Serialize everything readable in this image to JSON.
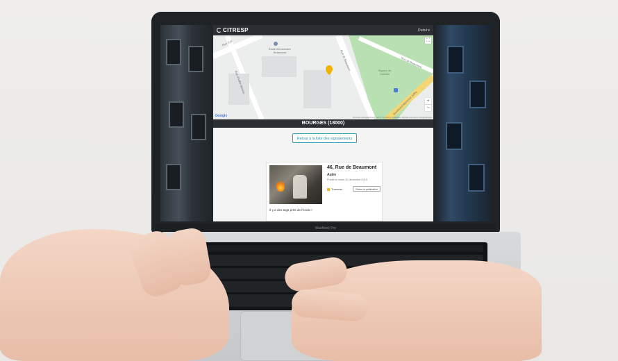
{
  "app": {
    "brand": "CITRESP",
    "user_menu": "Dudul ▾"
  },
  "map": {
    "streets": [
      "Rue Coli",
      "Rue d'Abbé Moreau",
      "Rue de Beaumont",
      "Rue de Beaumont",
      "Boulevard Maréchal Joffre"
    ],
    "places": [
      "École élémentaire Beaumont",
      "Square de Celestin"
    ],
    "zoom_in": "+",
    "zoom_out": "−",
    "fullscreen": "⛶",
    "provider": "Google",
    "attribution": "Données cartographiques ©2017   Conditions d'utilisation   Signaler une erreur cartographique"
  },
  "city": "BOURGES (18000)",
  "back_button": "Retour à la liste des signalements",
  "report": {
    "address": "46, Rue de Beaumont",
    "category": "Autre",
    "date": "Publié le mardi 10 décembre 2019",
    "status": "Transmis",
    "follow_button": "Suivre la publication",
    "description": "Il y a des tags près de l'école !"
  },
  "laptop": {
    "model": "MacBook Pro"
  },
  "colors": {
    "navbar": "#2b2f33",
    "accent": "#2aa3b8",
    "status": "#f0b323"
  }
}
